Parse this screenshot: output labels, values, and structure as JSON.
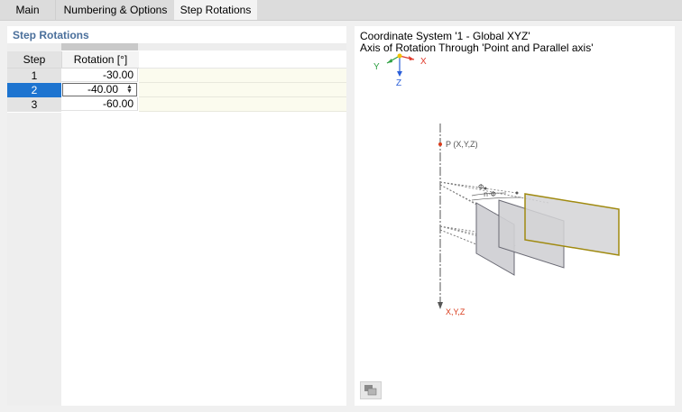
{
  "tabs": [
    {
      "label": "Main",
      "active": false
    },
    {
      "label": "Numbering & Options",
      "active": false
    },
    {
      "label": "Step Rotations",
      "active": true
    }
  ],
  "left": {
    "section_title": "Step Rotations",
    "columns": {
      "step": "Step",
      "rotation": "Rotation [°]"
    },
    "rows": [
      {
        "step": "1",
        "rotation": "-30.00",
        "selected": false
      },
      {
        "step": "2",
        "rotation": "-40.00",
        "selected": true
      },
      {
        "step": "3",
        "rotation": "-60.00",
        "selected": false
      }
    ]
  },
  "right": {
    "coord_line": "Coordinate System '1 - Global XYZ'",
    "axis_line": "Axis of Rotation Through 'Point and Parallel axis'",
    "axes": {
      "x": "X",
      "y": "Y",
      "z": "Z"
    },
    "diagram": {
      "point_label": "P (X,Y,Z)",
      "phi_label": "Φ",
      "nphi_label": "n·Φ",
      "axis_label": "X,Y,Z"
    },
    "toolbar_icon": "view-options-icon"
  },
  "colors": {
    "selected_row": "#1d74d0",
    "section_title": "#4a6f9b",
    "x_axis": "#e0392b",
    "y_axis": "#2ea043",
    "z_axis": "#2b5fd9",
    "highlight_plane": "#a08a10",
    "point": "#d93a1a"
  }
}
